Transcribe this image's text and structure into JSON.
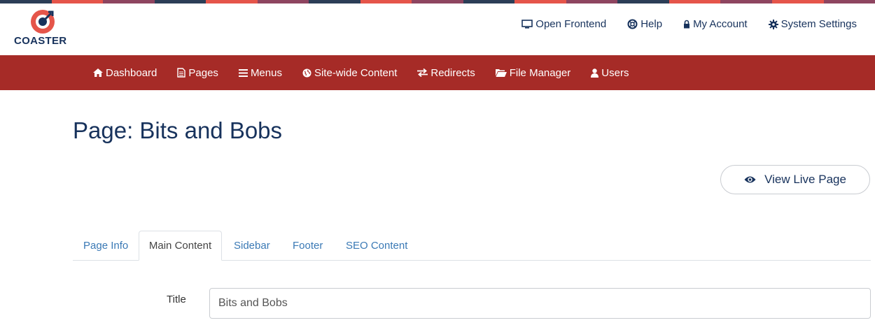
{
  "brand": {
    "name": "COASTER",
    "stripe_colors": [
      "#2c3e57",
      "#e5554a",
      "#8e4560",
      "#2c3e57",
      "#e5554a",
      "#8e4560",
      "#2c3e57",
      "#e5554a",
      "#8e4560",
      "#2c3e57",
      "#e5554a",
      "#8e4560",
      "#2c3e57",
      "#e5554a",
      "#8e4560",
      "#e5554a",
      "#8e4560"
    ],
    "accent": "#a62b27",
    "navy": "#17325c"
  },
  "topnav": {
    "items": [
      {
        "label": "Open Frontend",
        "icon": "monitor-icon"
      },
      {
        "label": "Help",
        "icon": "lifebuoy-icon"
      },
      {
        "label": "My Account",
        "icon": "lock-icon"
      },
      {
        "label": "System Settings",
        "icon": "gear-icon"
      }
    ]
  },
  "mainnav": {
    "items": [
      {
        "label": "Dashboard",
        "icon": "home-icon"
      },
      {
        "label": "Pages",
        "icon": "file-icon"
      },
      {
        "label": "Menus",
        "icon": "bars-icon"
      },
      {
        "label": "Site-wide Content",
        "icon": "globe-icon"
      },
      {
        "label": "Redirects",
        "icon": "exchange-icon"
      },
      {
        "label": "File Manager",
        "icon": "folder-open-icon"
      },
      {
        "label": "Users",
        "icon": "user-icon"
      }
    ]
  },
  "page": {
    "title": "Page: Bits and Bobs",
    "view_live_label": "View Live Page"
  },
  "tabs": [
    {
      "label": "Page Info",
      "active": false
    },
    {
      "label": "Main Content",
      "active": true
    },
    {
      "label": "Sidebar",
      "active": false
    },
    {
      "label": "Footer",
      "active": false
    },
    {
      "label": "SEO Content",
      "active": false
    }
  ],
  "form": {
    "title_label": "Title",
    "title_value": "Bits and Bobs"
  }
}
